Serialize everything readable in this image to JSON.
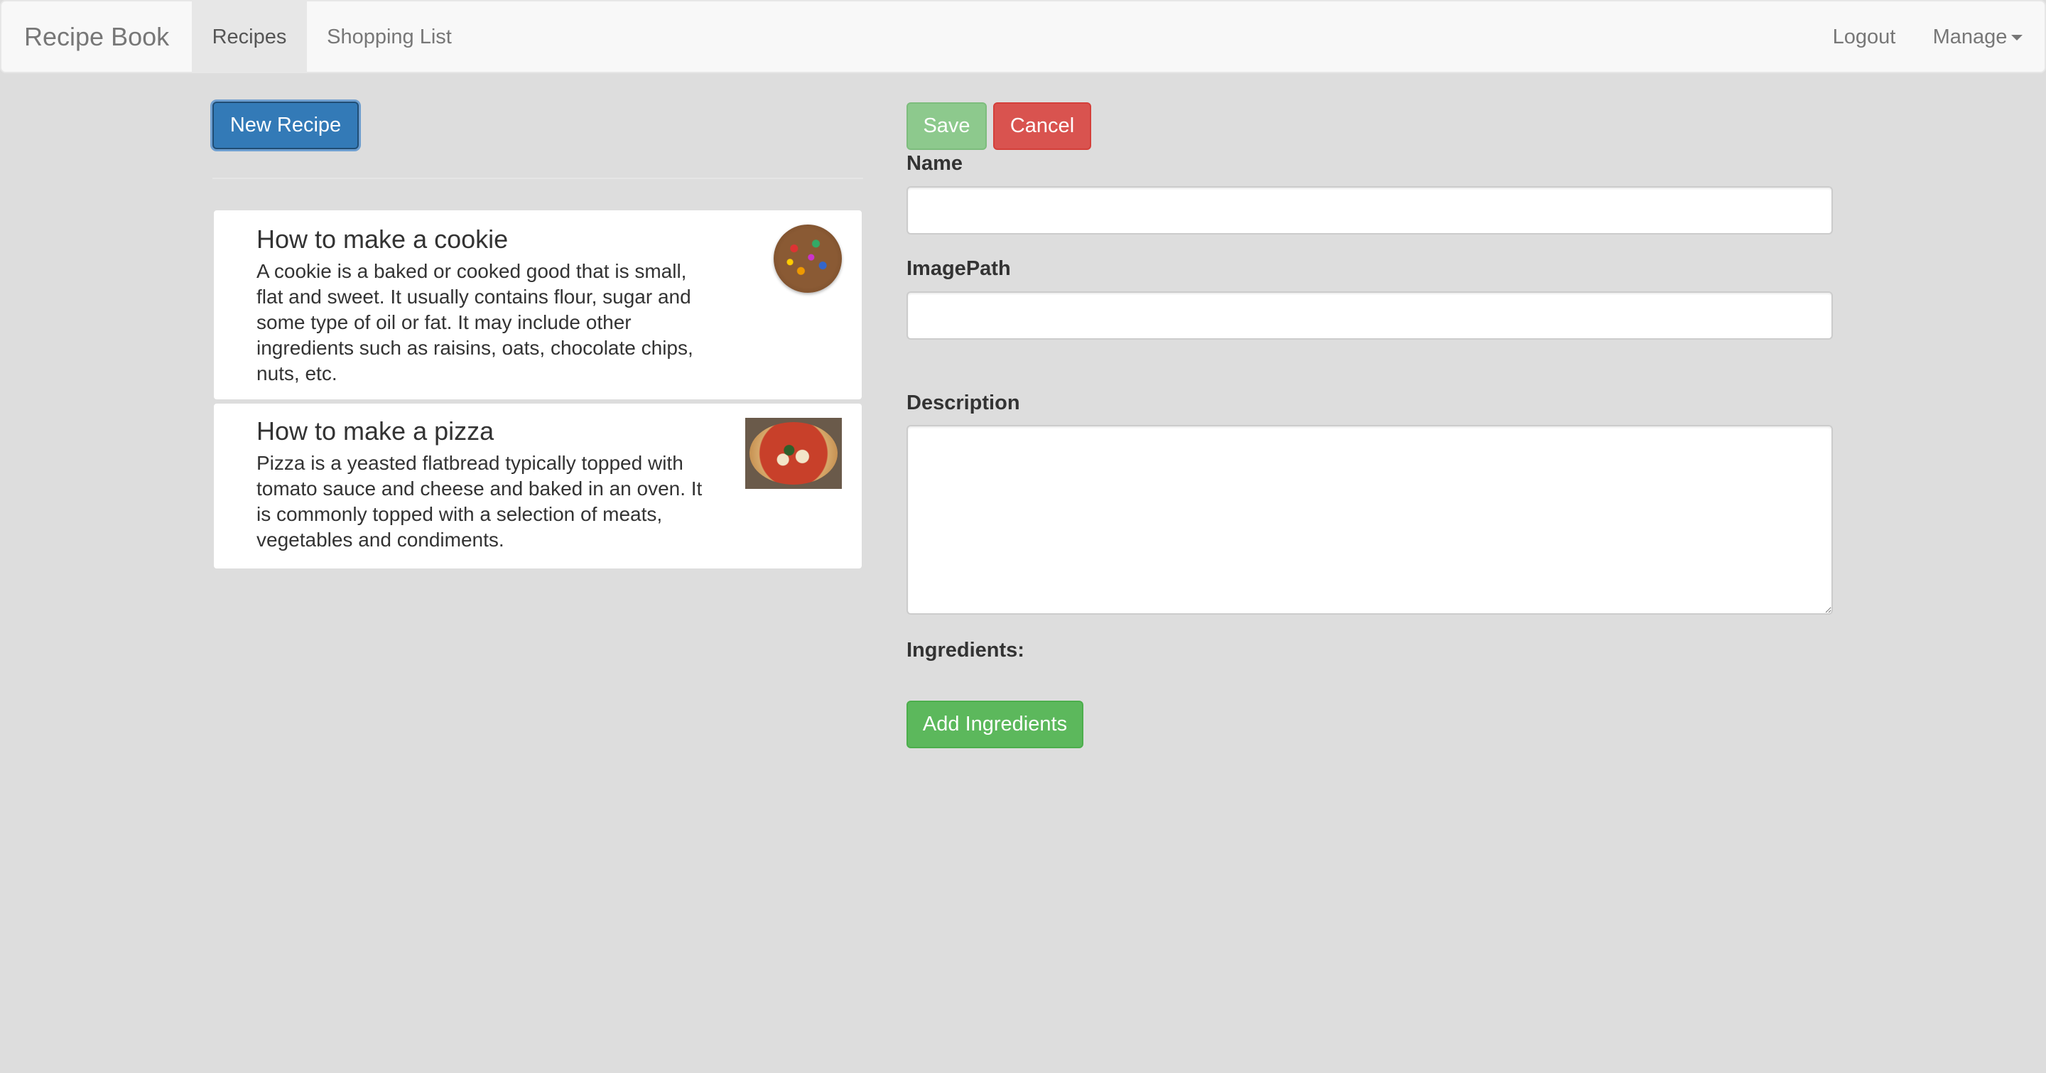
{
  "navbar": {
    "brand": "Recipe Book",
    "tabs": [
      {
        "label": "Recipes",
        "active": true
      },
      {
        "label": "Shopping List",
        "active": false
      }
    ],
    "logout_label": "Logout",
    "manage_label": "Manage"
  },
  "recipe_list": {
    "new_recipe_label": "New Recipe",
    "items": [
      {
        "title": "How to make a cookie",
        "description": "A cookie is a baked or cooked good that is small, flat and sweet. It usually contains flour, sugar and some type of oil or fat. It may include other ingredients such as raisins, oats, chocolate chips, nuts, etc.",
        "image": "cookie-image"
      },
      {
        "title": "How to make a pizza",
        "description": "Pizza is a yeasted flatbread typically topped with tomato sauce and cheese and baked in an oven. It is commonly topped with a selection of meats, vegetables and condiments.",
        "image": "pizza-image"
      }
    ]
  },
  "recipe_form": {
    "save_label": "Save",
    "cancel_label": "Cancel",
    "name_label": "Name",
    "name_value": "",
    "imagepath_label": "ImagePath",
    "imagepath_value": "",
    "description_label": "Description",
    "description_value": "",
    "ingredients_label": "Ingredients:",
    "add_ingredients_label": "Add Ingredients"
  },
  "colors": {
    "primary": "#337ab7",
    "success": "#5cb85c",
    "success_disabled": "#8dc98d",
    "danger": "#d9534f",
    "background": "#dddddd",
    "navbar": "#f8f8f8"
  }
}
